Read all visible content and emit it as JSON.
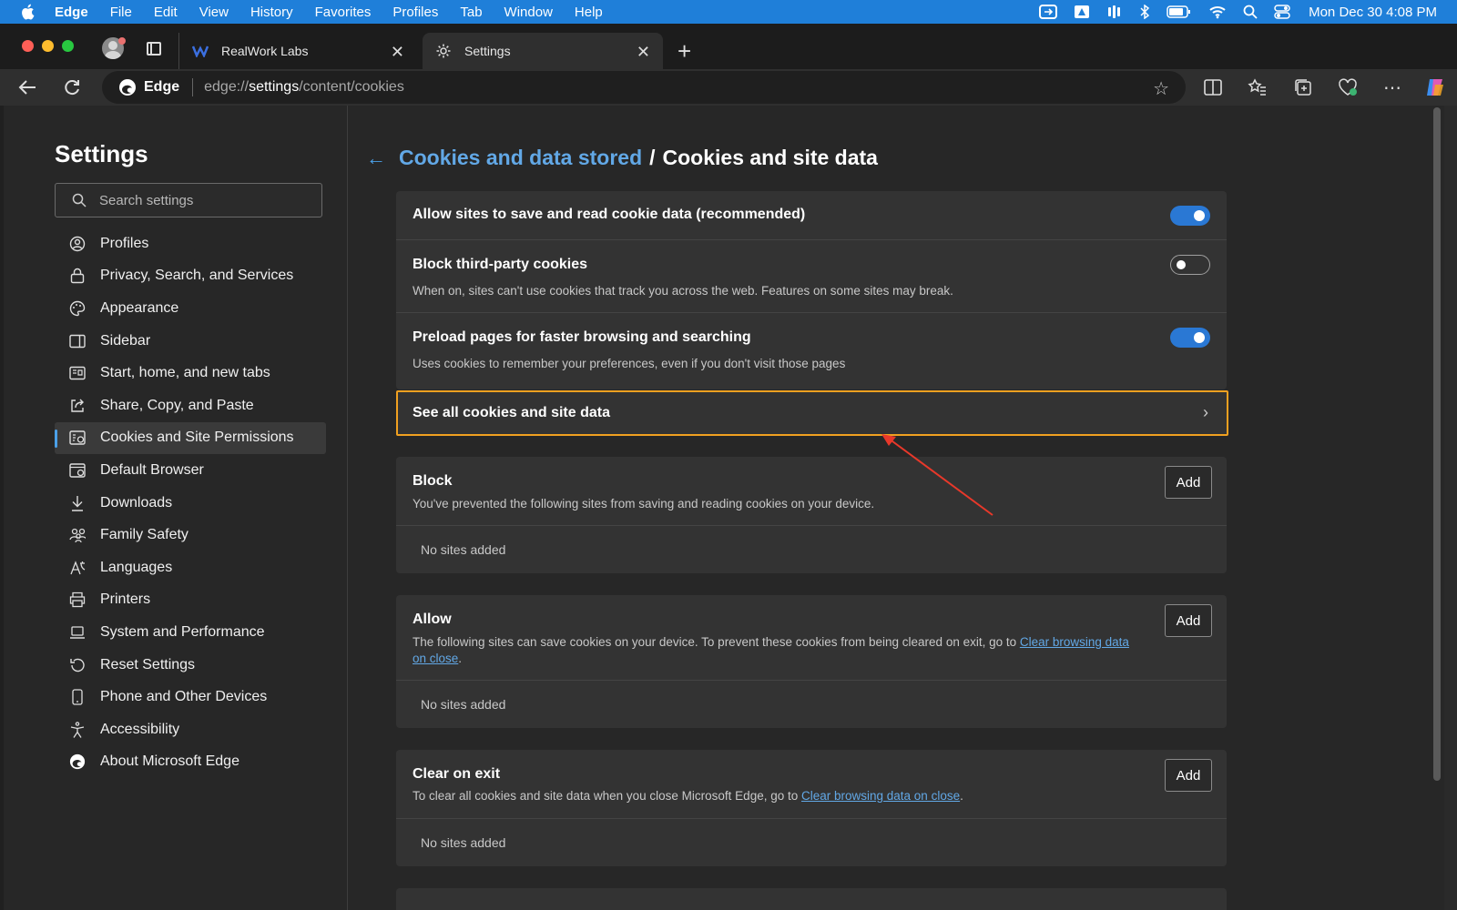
{
  "menubar": {
    "app": "Edge",
    "items": [
      "File",
      "Edit",
      "View",
      "History",
      "Favorites",
      "Profiles",
      "Tab",
      "Window",
      "Help"
    ],
    "clock": "Mon Dec 30  4:08 PM"
  },
  "tabs": [
    {
      "title": "RealWork Labs",
      "icon": "realwork-logo-icon"
    },
    {
      "title": "Settings",
      "icon": "gear-icon",
      "active": true
    }
  ],
  "address": {
    "brand": "Edge",
    "url_prefix": "edge://",
    "url_host": "settings",
    "url_path": "/content/cookies"
  },
  "sidebar": {
    "title": "Settings",
    "search_placeholder": "Search settings",
    "items": [
      {
        "label": "Profiles",
        "icon": "profiles-icon"
      },
      {
        "label": "Privacy, Search, and Services",
        "icon": "lock-icon"
      },
      {
        "label": "Appearance",
        "icon": "palette-icon"
      },
      {
        "label": "Sidebar",
        "icon": "sidebar-icon"
      },
      {
        "label": "Start, home, and new tabs",
        "icon": "home-tabs-icon"
      },
      {
        "label": "Share, Copy, and Paste",
        "icon": "share-icon"
      },
      {
        "label": "Cookies and Site Permissions",
        "icon": "cookies-icon",
        "active": true
      },
      {
        "label": "Default Browser",
        "icon": "browser-icon"
      },
      {
        "label": "Downloads",
        "icon": "download-icon"
      },
      {
        "label": "Family Safety",
        "icon": "family-icon"
      },
      {
        "label": "Languages",
        "icon": "languages-icon"
      },
      {
        "label": "Printers",
        "icon": "printer-icon"
      },
      {
        "label": "System and Performance",
        "icon": "laptop-icon"
      },
      {
        "label": "Reset Settings",
        "icon": "reset-icon"
      },
      {
        "label": "Phone and Other Devices",
        "icon": "phone-icon"
      },
      {
        "label": "Accessibility",
        "icon": "accessibility-icon"
      },
      {
        "label": "About Microsoft Edge",
        "icon": "edge-logo-icon"
      }
    ]
  },
  "breadcrumb": {
    "parent": "Cookies and data stored",
    "separator": "/",
    "current": "Cookies and site data"
  },
  "settings": {
    "allow": {
      "title": "Allow sites to save and read cookie data (recommended)",
      "on": true
    },
    "third_party": {
      "title": "Block third-party cookies",
      "desc": "When on, sites can't use cookies that track you across the web. Features on some sites may break.",
      "on": false
    },
    "preload": {
      "title": "Preload pages for faster browsing and searching",
      "desc": "Uses cookies to remember your preferences, even if you don't visit those pages",
      "on": true
    },
    "see_all": "See all cookies and site data"
  },
  "sections": {
    "block": {
      "title": "Block",
      "desc": "You've prevented the following sites from saving and reading cookies on your device.",
      "add": "Add",
      "empty": "No sites added"
    },
    "allow": {
      "title": "Allow",
      "desc_before": "The following sites can save cookies on your device. To prevent these cookies from being cleared on exit, go to ",
      "link": "Clear browsing data on close",
      "desc_after": ".",
      "add": "Add",
      "empty": "No sites added"
    },
    "clear": {
      "title": "Clear on exit",
      "desc_before": "To clear all cookies and site data when you close Microsoft Edge, go to ",
      "link": "Clear browsing data on close",
      "desc_after": ".",
      "add": "Add",
      "empty": "No sites added"
    }
  },
  "colors": {
    "accent": "#4ba0e8",
    "highlight_border": "#f0a020",
    "annotation_arrow": "#e8382a",
    "menubar": "#1f7fd9"
  }
}
